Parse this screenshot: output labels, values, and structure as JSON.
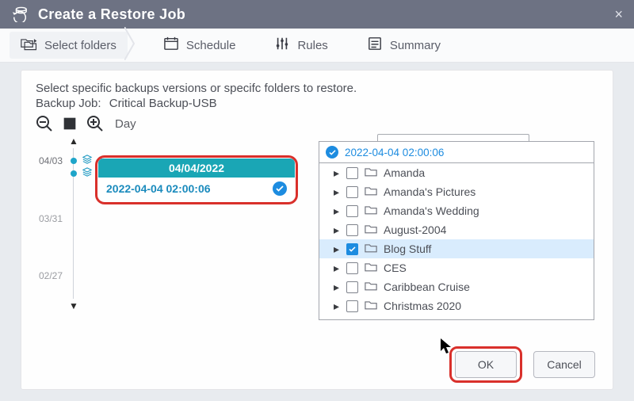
{
  "titlebar": {
    "title": "Create a Restore Job"
  },
  "steps": {
    "select_folders": "Select folders",
    "schedule": "Schedule",
    "rules": "Rules",
    "summary": "Summary"
  },
  "body": {
    "instruction": "Select specific backups versions or specifc folders to restore.",
    "backup_job_label": "Backup Job:",
    "backup_job_name": "Critical Backup-USB",
    "zoom_label": "Day"
  },
  "timeline": {
    "ticks": [
      {
        "label": "04/03",
        "count": "1"
      },
      {
        "label": "",
        "count": "1"
      }
    ],
    "labels": {
      "l_0331": "03/31",
      "l_0227": "02/27"
    },
    "highlight": {
      "date": "04/04/2022",
      "timestamp": "2022-04-04 02:00:06"
    }
  },
  "tree": {
    "header_timestamp": "2022-04-04 02:00:06",
    "items": [
      {
        "name": "Amanda",
        "checked": false,
        "selected": false
      },
      {
        "name": "Amanda's Pictures",
        "checked": false,
        "selected": false
      },
      {
        "name": "Amanda's Wedding",
        "checked": false,
        "selected": false
      },
      {
        "name": "August-2004",
        "checked": false,
        "selected": false
      },
      {
        "name": "Blog Stuff",
        "checked": true,
        "selected": true
      },
      {
        "name": "CES",
        "checked": false,
        "selected": false
      },
      {
        "name": "Caribbean Cruise",
        "checked": false,
        "selected": false
      },
      {
        "name": "Christmas 2020",
        "checked": false,
        "selected": false
      }
    ]
  },
  "footer": {
    "ok": "OK",
    "cancel": "Cancel"
  }
}
